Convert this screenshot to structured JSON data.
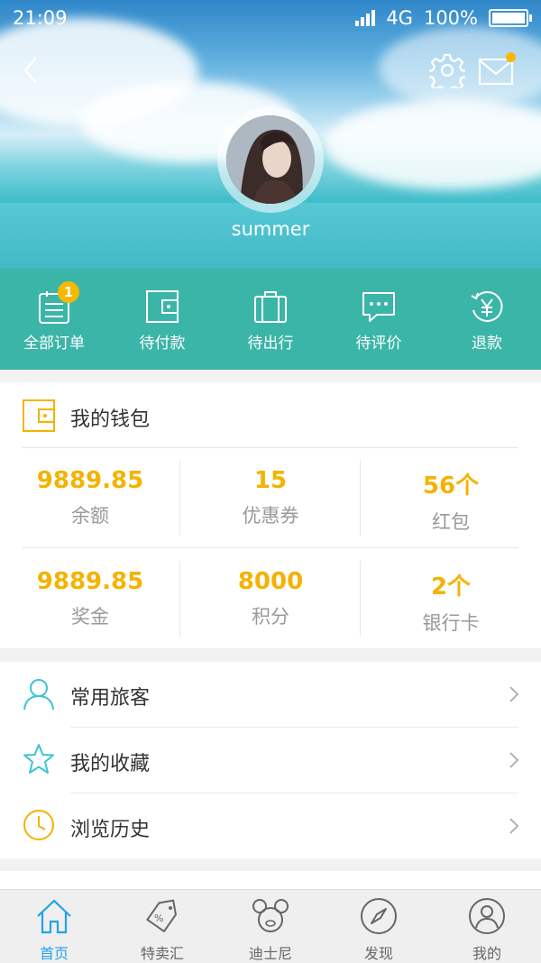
{
  "status_bar": {
    "time": "21:09",
    "network": "4G",
    "battery": "100%",
    "battery_level": 1.0
  },
  "profile": {
    "username": "summer"
  },
  "header": {
    "back_icon": "chevron-left-icon",
    "settings_icon": "gear-icon",
    "messages_icon": "mail-icon",
    "has_unread_messages": true
  },
  "orders": [
    {
      "label": "全部订单",
      "icon": "clipboard-list-icon",
      "badge": "1"
    },
    {
      "label": "待付款",
      "icon": "wallet-icon",
      "badge": ""
    },
    {
      "label": "待出行",
      "icon": "suitcase-icon",
      "badge": ""
    },
    {
      "label": "待评价",
      "icon": "chat-bubble-icon",
      "badge": ""
    },
    {
      "label": "退款",
      "icon": "yen-refund-icon",
      "badge": ""
    }
  ],
  "wallet": {
    "title": "我的钱包",
    "icon": "wallet-icon",
    "rows": [
      [
        {
          "value": "9889.85",
          "label": "余额"
        },
        {
          "value": "15",
          "label": "优惠券"
        },
        {
          "value": "56个",
          "label": "红包"
        }
      ],
      [
        {
          "value": "9889.85",
          "label": "奖金"
        },
        {
          "value": "8000",
          "label": "积分"
        },
        {
          "value": "2个",
          "label": "银行卡"
        }
      ]
    ]
  },
  "menu": [
    {
      "label": "常用旅客",
      "icon": "person-icon"
    },
    {
      "label": "我的收藏",
      "icon": "star-icon"
    },
    {
      "label": "浏览历史",
      "icon": "clock-icon"
    }
  ],
  "tabs": [
    {
      "label": "首页",
      "icon": "home-icon",
      "active": true
    },
    {
      "label": "特卖汇",
      "icon": "discount-tag-icon",
      "active": false
    },
    {
      "label": "迪士尼",
      "icon": "mickey-icon",
      "active": false
    },
    {
      "label": "发现",
      "icon": "compass-icon",
      "active": false
    },
    {
      "label": "我的",
      "icon": "user-icon",
      "active": false
    }
  ],
  "colors": {
    "accent_teal": "#3bb5a8",
    "value_yellow": "#f3b300",
    "tab_active_blue": "#22a3e6",
    "badge_yellow": "#f6b800",
    "menu_icon_teal": "#3cc3d6",
    "menu_icon_yellow": "#f3b300",
    "star_teal": "#3cc3d6"
  }
}
